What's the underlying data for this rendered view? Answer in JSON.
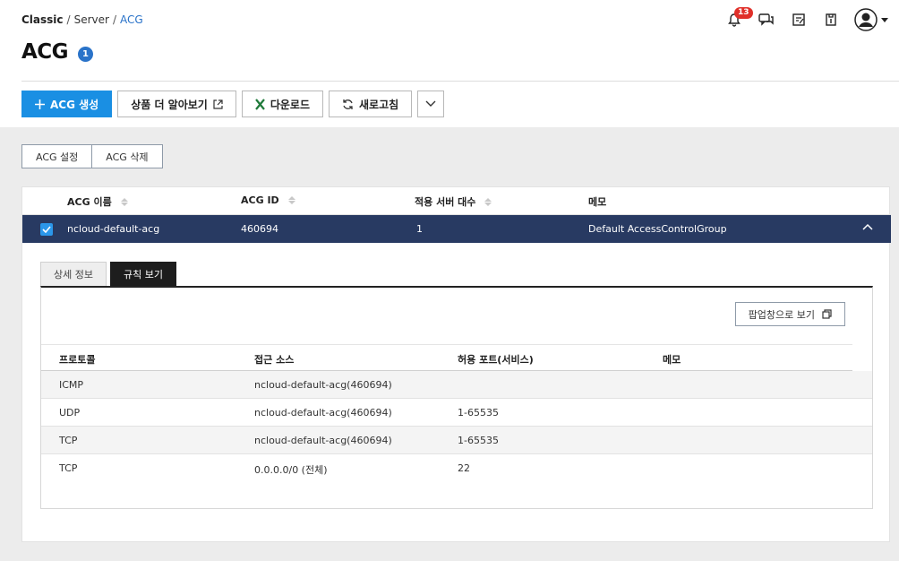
{
  "breadcrumb": {
    "root": "Classic",
    "sep": "/",
    "middle": "Server",
    "current": "ACG"
  },
  "page": {
    "title": "ACG",
    "count_badge": "1"
  },
  "header": {
    "notification_count": "13"
  },
  "toolbar": {
    "create_label": "ACG 생성",
    "learn_more_label": "상품 더 알아보기",
    "download_label": "다운로드",
    "refresh_label": "새로고침"
  },
  "subtoolbar": {
    "settings_label": "ACG 설정",
    "delete_label": "ACG 삭제"
  },
  "table": {
    "headers": {
      "name": "ACG 이름",
      "id": "ACG ID",
      "servers": "적용 서버 대수",
      "memo": "메모"
    },
    "selected_row": {
      "name": "ncloud-default-acg",
      "id": "460694",
      "servers": "1",
      "memo": "Default AccessControlGroup"
    }
  },
  "tabs": {
    "detail_label": "상세 정보",
    "rules_label": "규칙 보기"
  },
  "rules": {
    "popup_label": "팝업창으로 보기",
    "headers": {
      "protocol": "프로토콜",
      "source": "접근 소스",
      "port": "허용 포트(서비스)",
      "memo": "메모"
    },
    "rows": [
      {
        "protocol": "ICMP",
        "source": "ncloud-default-acg(460694)",
        "port": "",
        "memo": ""
      },
      {
        "protocol": "UDP",
        "source": "ncloud-default-acg(460694)",
        "port": "1-65535",
        "memo": ""
      },
      {
        "protocol": "TCP",
        "source": "ncloud-default-acg(460694)",
        "port": "1-65535",
        "memo": ""
      },
      {
        "protocol": "TCP",
        "source": "0.0.0.0/0 (전체)",
        "port": "22",
        "memo": ""
      }
    ]
  },
  "colors": {
    "primary": "#1a8fe3",
    "selected_row": "#283a62",
    "badge": "#2a73c9",
    "alert": "#e0302a"
  }
}
